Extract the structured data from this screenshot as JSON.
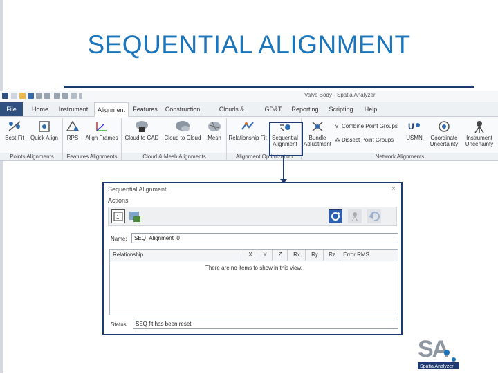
{
  "slide": {
    "title": "SEQUENTIAL ALIGNMENT"
  },
  "app": {
    "window_title": "Valve Body - SpatialAnalyzer",
    "tabs": [
      "File",
      "Home",
      "Instrument",
      "Alignment",
      "Features",
      "Construction",
      "Clouds & Surfaces",
      "GD&T",
      "Reporting",
      "Scripting",
      "Help"
    ],
    "active_tab": "Alignment",
    "tools": {
      "best_fit": "Best-Fit",
      "quick_align": "Quick Align",
      "rps": "RPS",
      "align_frames": "Align Frames",
      "cloud_to_cad": "Cloud to CAD",
      "cloud_to_cloud": "Cloud to Cloud",
      "mesh": "Mesh",
      "relationship_fit": "Relationship Fit",
      "sequential_alignment": "Sequential Alignment",
      "bundle_adjustment": "Bundle Adjustment",
      "combine_point_groups": "Combine Point Groups",
      "dissect_point_groups": "Dissect Point Groups",
      "usmn": "USMN",
      "coordinate_uncertainty": "Coordinate Uncertainty",
      "instrument_uncertainty": "Instrument Uncertainty"
    },
    "groups": {
      "points_alignments": "Points Alignments",
      "features_alignments": "Features Alignments",
      "cloud_mesh_alignments": "Cloud & Mesh Alignments",
      "alignment_optimization": "Alignment Optimization",
      "network_alignments": "Network Alignments"
    }
  },
  "dialog": {
    "title": "Sequential Alignment",
    "close": "×",
    "actions_label": "Actions",
    "name_label": "Name:",
    "name_value": "SEQ_Alignment_0",
    "columns": [
      "Relationship",
      "X",
      "Y",
      "Z",
      "Rx",
      "Ry",
      "Rz",
      "Error RMS"
    ],
    "empty_message": "There are no items to show in this view.",
    "status_label": "Status:",
    "status_value": "SEQ fit has been reset"
  },
  "logo": {
    "text_big": "SA",
    "text_small": "SpatialAnalyzer"
  },
  "colors": {
    "accent": "#1b75bb",
    "frame": "#1e3a70",
    "file_tab": "#2f4f7f"
  }
}
